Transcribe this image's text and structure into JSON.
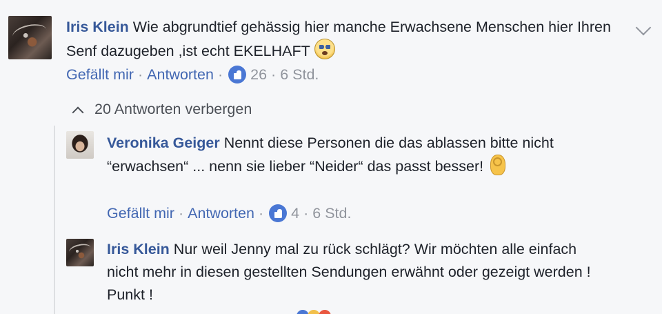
{
  "comments": [
    {
      "author": "Iris Klein",
      "text": "Wie abgrundtief gehässig hier manche Erwachsene Menschen hier Ihren Senf dazugeben ,ist echt EKELHAFT",
      "emoji": "fearful-face-emoji",
      "like_label": "Gefällt mir",
      "reply_label": "Antworten",
      "likes": "26",
      "time": "6 Std."
    },
    {
      "author": "Veronika Geiger",
      "text": "Nennt diese Personen die das ablassen bitte nicht “erwachsen“ ... nenn sie lieber “Neider“ das passt besser!",
      "emoji": "ok-hand-emoji",
      "like_label": "Gefällt mir",
      "reply_label": "Antworten",
      "likes": "4",
      "time": "6 Std."
    },
    {
      "author": "Iris Klein",
      "text": "Nur weil Jenny mal zu rück schlägt? Wir möchten alle einfach nicht mehr in diesen gestellten Sendungen erwähnt oder gezeigt werden ! Punkt !"
    }
  ],
  "replies_toggle": "20 Antworten verbergen",
  "colors": {
    "background": "#f6f7f9",
    "author": "#365899",
    "link": "#4267b2",
    "meta": "#90949c",
    "like_badge": "#4a77d4"
  }
}
